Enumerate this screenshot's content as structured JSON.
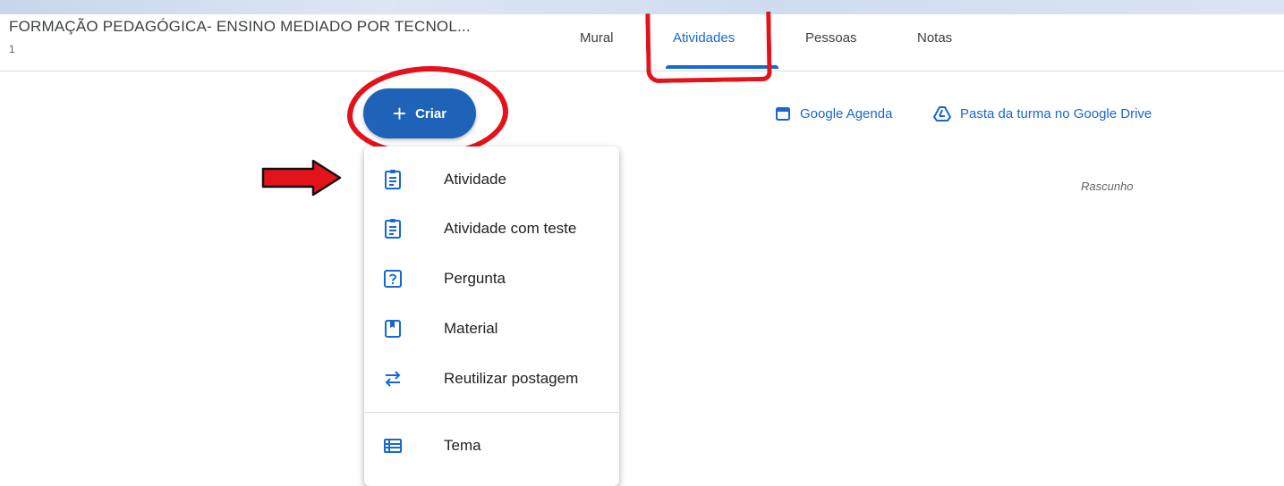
{
  "course": {
    "title": "FORMAÇÃO PEDAGÓGICA- ENSINO MEDIADO POR TECNOL...",
    "section": "1"
  },
  "tabs": [
    {
      "label": "Mural",
      "active": false
    },
    {
      "label": "Atividades",
      "active": true
    },
    {
      "label": "Pessoas",
      "active": false
    },
    {
      "label": "Notas",
      "active": false
    }
  ],
  "create_button": {
    "label": "Criar",
    "icon": "plus-icon"
  },
  "links": [
    {
      "label": "Google Agenda",
      "icon": "calendar-icon"
    },
    {
      "label": "Pasta da turma no Google Drive",
      "icon": "drive-icon"
    }
  ],
  "draft_label": "Rascunho",
  "menu": {
    "items": [
      {
        "label": "Atividade",
        "icon": "assignment-icon"
      },
      {
        "label": "Atividade com teste",
        "icon": "quiz-assignment-icon"
      },
      {
        "label": "Pergunta",
        "icon": "question-icon"
      },
      {
        "label": "Material",
        "icon": "book-icon"
      },
      {
        "label": "Reutilizar postagem",
        "icon": "repeat-icon"
      },
      {
        "label": "Tema",
        "icon": "topic-list-icon"
      }
    ]
  },
  "colors": {
    "accent": "#1967d2",
    "button_bg": "#1e63b8",
    "annotation_red": "#e3121b"
  }
}
